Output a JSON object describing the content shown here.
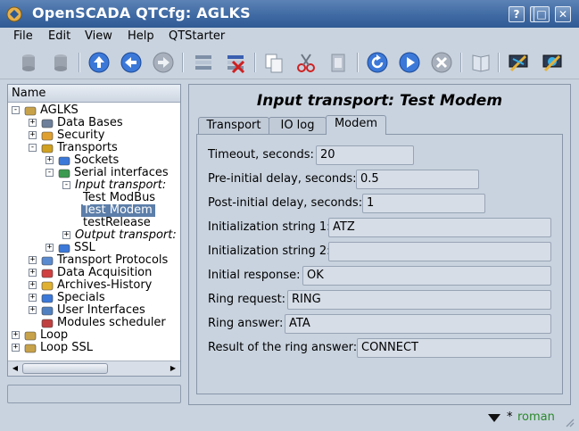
{
  "window": {
    "title": "OpenSCADA QTCfg: AGLKS",
    "buttons": [
      "help-button",
      "minimize-button",
      "maximize-button",
      "close-button"
    ]
  },
  "menu": {
    "file": "File",
    "edit": "Edit",
    "view": "View",
    "help": "Help",
    "qtstarter": "QTStarter"
  },
  "toolbar": {
    "icons": [
      "db-load-icon",
      "db-save-icon",
      "up-icon",
      "back-icon",
      "forward-icon",
      "add-item-icon",
      "delete-item-icon",
      "copy-icon",
      "cut-icon",
      "paste-icon",
      "refresh-icon",
      "start-icon",
      "stop-icon",
      "manual-icon",
      "logo-icon-1",
      "logo-icon-2"
    ]
  },
  "tree": {
    "header": "Name",
    "items": [
      {
        "label": "AGLKS",
        "level": 0,
        "expander": "-",
        "italic": false,
        "selected": false,
        "icon": "station-icon"
      },
      {
        "label": "Data Bases",
        "level": 1,
        "expander": "+",
        "italic": false,
        "selected": false,
        "icon": "database-icon"
      },
      {
        "label": "Security",
        "level": 1,
        "expander": "+",
        "italic": false,
        "selected": false,
        "icon": "security-icon"
      },
      {
        "label": "Transports",
        "level": 1,
        "expander": "-",
        "italic": false,
        "selected": false,
        "icon": "transports-icon"
      },
      {
        "label": "Sockets",
        "level": 2,
        "expander": "+",
        "italic": false,
        "selected": false,
        "icon": "sockets-icon"
      },
      {
        "label": "Serial interfaces",
        "level": 2,
        "expander": "-",
        "italic": false,
        "selected": false,
        "icon": "serial-icon"
      },
      {
        "label": "Input transport:",
        "level": 3,
        "expander": "-",
        "italic": true,
        "selected": false,
        "icon": ""
      },
      {
        "label": "Test ModBus",
        "level": 4,
        "expander": "",
        "italic": false,
        "selected": false,
        "icon": ""
      },
      {
        "label": "Test Modem",
        "level": 4,
        "expander": "",
        "italic": false,
        "selected": true,
        "icon": ""
      },
      {
        "label": "testRelease",
        "level": 4,
        "expander": "",
        "italic": false,
        "selected": false,
        "icon": ""
      },
      {
        "label": "Output transport:",
        "level": 3,
        "expander": "+",
        "italic": true,
        "selected": false,
        "icon": ""
      },
      {
        "label": "SSL",
        "level": 2,
        "expander": "+",
        "italic": false,
        "selected": false,
        "icon": "ssl-icon"
      },
      {
        "label": "Transport Protocols",
        "level": 1,
        "expander": "+",
        "italic": false,
        "selected": false,
        "icon": "protocols-icon"
      },
      {
        "label": "Data Acquisition",
        "level": 1,
        "expander": "+",
        "italic": false,
        "selected": false,
        "icon": "acquisition-icon"
      },
      {
        "label": "Archives-History",
        "level": 1,
        "expander": "+",
        "italic": false,
        "selected": false,
        "icon": "archives-icon"
      },
      {
        "label": "Specials",
        "level": 1,
        "expander": "+",
        "italic": false,
        "selected": false,
        "icon": "specials-icon"
      },
      {
        "label": "User Interfaces",
        "level": 1,
        "expander": "+",
        "italic": false,
        "selected": false,
        "icon": "ui-icon"
      },
      {
        "label": "Modules scheduler",
        "level": 1,
        "expander": "",
        "italic": false,
        "selected": false,
        "icon": "scheduler-icon"
      },
      {
        "label": "Loop",
        "level": 0,
        "expander": "+",
        "italic": false,
        "selected": false,
        "icon": "station-icon"
      },
      {
        "label": "Loop SSL",
        "level": 0,
        "expander": "+",
        "italic": false,
        "selected": false,
        "icon": "station-icon"
      }
    ]
  },
  "main": {
    "title": "Input transport: Test Modem",
    "tabs": [
      {
        "label": "Transport",
        "active": false
      },
      {
        "label": "IO log",
        "active": false
      },
      {
        "label": "Modem",
        "active": true
      }
    ],
    "fields": [
      {
        "label": "Timeout, seconds:",
        "value": "20"
      },
      {
        "label": "Pre-initial delay, seconds:",
        "value": "0.5"
      },
      {
        "label": "Post-initial delay, seconds:",
        "value": "1"
      },
      {
        "label": "Initialization string 1:",
        "value": "ATZ"
      },
      {
        "label": "Initialization string 2:",
        "value": ""
      },
      {
        "label": "Initial response:",
        "value": "OK"
      },
      {
        "label": "Ring request:",
        "value": "RING"
      },
      {
        "label": "Ring answer:",
        "value": "ATA"
      },
      {
        "label": "Result of the ring answer:",
        "value": "CONNECT"
      }
    ]
  },
  "status": {
    "modified_mark": "*",
    "user": "roman"
  },
  "colors": {
    "titlebar": "#3f6aa3",
    "selection": "#5c7ea9",
    "window_bg": "#c9d3df",
    "user_text": "#2a8a2a"
  }
}
